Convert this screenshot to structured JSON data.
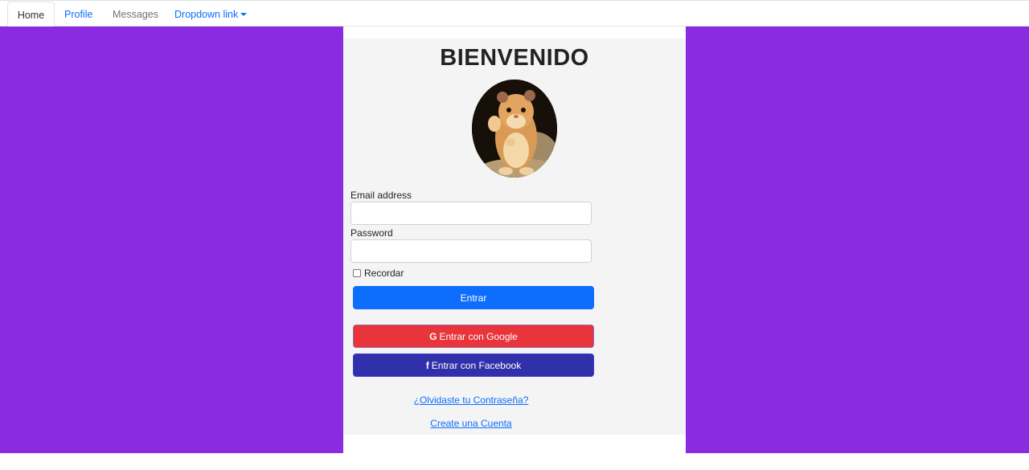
{
  "nav": {
    "tabs": [
      {
        "label": "Home",
        "active": true
      },
      {
        "label": "Profile"
      },
      {
        "label": "Messages"
      },
      {
        "label": "Dropdown link",
        "icon": "caret-down-icon"
      }
    ]
  },
  "login": {
    "title": "BIENVENIDO",
    "email_label": "Email address",
    "email_value": "",
    "password_label": "Password",
    "password_value": "",
    "remember_label": "Recordar",
    "remember_checked": false,
    "submit_label": "Entrar",
    "google": {
      "icon_glyph": "G",
      "label": "Entrar con Google"
    },
    "facebook": {
      "icon_glyph": "f",
      "label": "Entrar con Facebook"
    },
    "forgot_link": "¿Olvidaste tu Contraseña?",
    "create_link": "Create una Cuenta"
  },
  "colors": {
    "background": "#8a2be2",
    "panel": "#f4f4f4",
    "primary": "#0d6efd",
    "google": "#e8343a",
    "facebook": "#3030ab"
  }
}
